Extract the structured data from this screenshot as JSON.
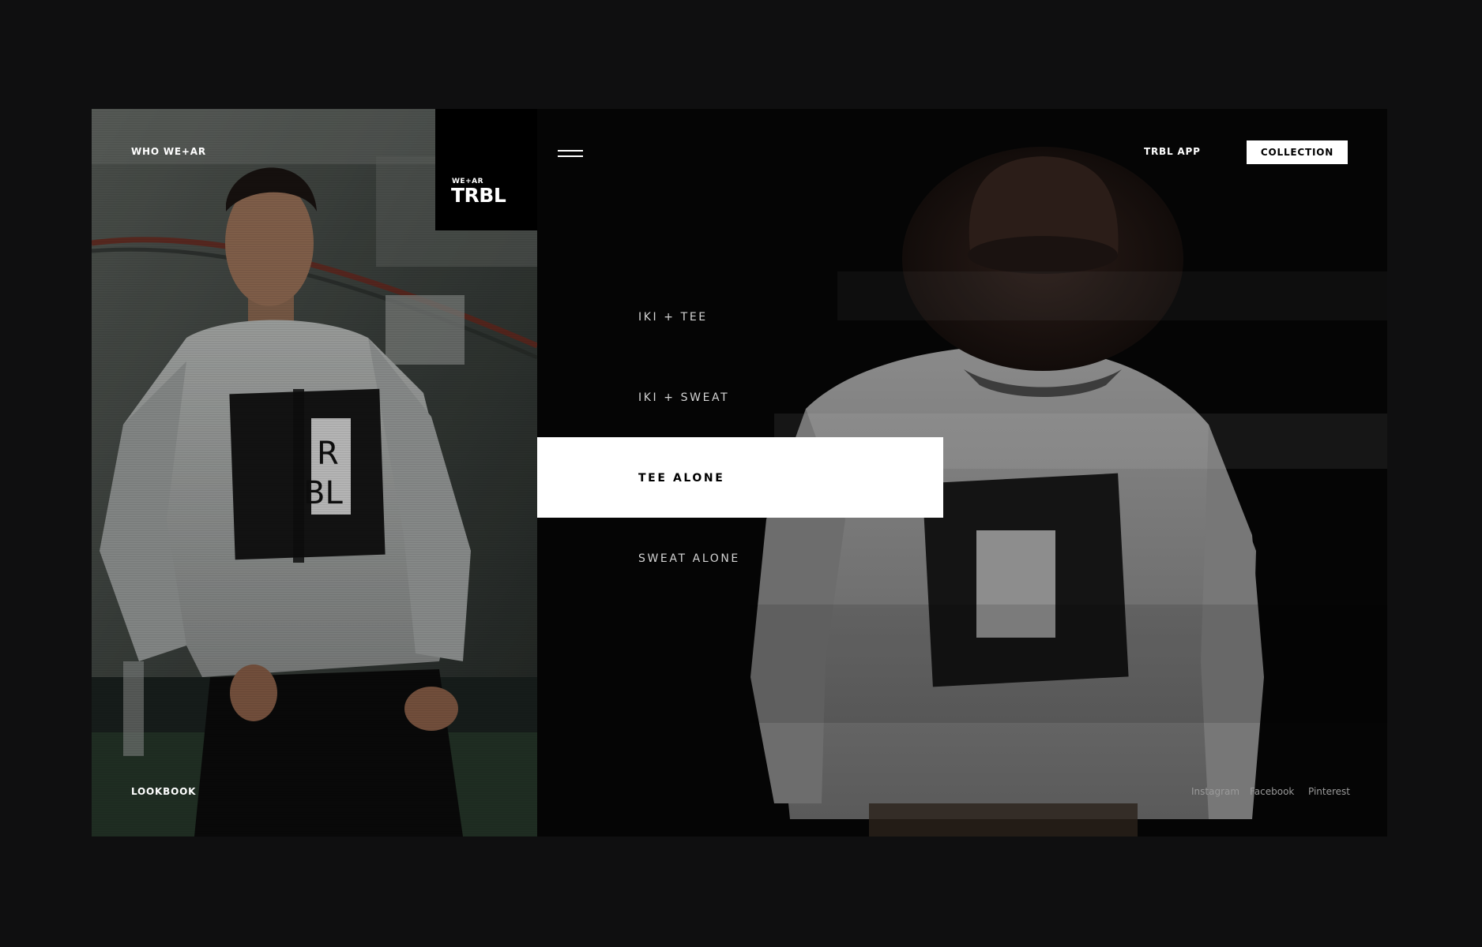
{
  "nav": {
    "who_wear": "WHO WE+AR",
    "lookbook": "LOOKBOOK",
    "trbl_app": "TRBL APP",
    "collection": "COLLECTION"
  },
  "logo": {
    "small": "WE+AR",
    "big": "TRBL"
  },
  "left_photo_print": {
    "line1": "R",
    "line2": "BL"
  },
  "menu": {
    "items": [
      {
        "label": "IKI + TEE",
        "active": false
      },
      {
        "label": "IKI + SWEAT",
        "active": false
      },
      {
        "label": "TEE ALONE",
        "active": true
      },
      {
        "label": "SWEAT ALONE",
        "active": false
      }
    ]
  },
  "social": {
    "instagram": "Instagram",
    "facebook": "Facebook",
    "pinterest": "Pinterest"
  },
  "colors": {
    "page_bg": "#0f0f10",
    "panel_bg": "#050505",
    "accent": "#ffffff",
    "muted_text": "#9a9a9a"
  },
  "icons": {
    "menu": "hamburger-icon"
  }
}
